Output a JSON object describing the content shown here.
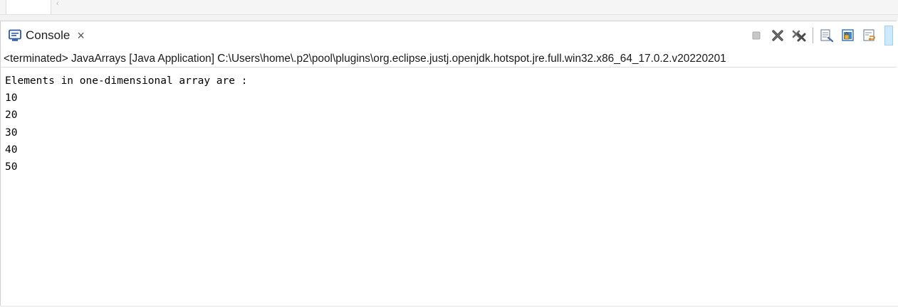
{
  "view": {
    "tab_label": "Console",
    "tab_close": "×",
    "tab_icon": "console-icon",
    "toolbar": [
      {
        "name": "terminate-icon"
      },
      {
        "name": "remove-launch-icon"
      },
      {
        "name": "remove-all-terminated-icon"
      },
      {
        "name": "clear-console-icon"
      },
      {
        "name": "scroll-lock-icon"
      },
      {
        "name": "word-wrap-icon"
      }
    ]
  },
  "status": {
    "text": "<terminated> JavaArrays [Java Application] C:\\Users\\home\\.p2\\pool\\plugins\\org.eclipse.justj.openjdk.hotspot.jre.full.win32.x86_64_17.0.2.v20220201"
  },
  "output": {
    "lines": [
      "Elements in one-dimensional array are :",
      "10",
      "20",
      "30",
      "40",
      "50"
    ]
  },
  "colors": {
    "accent": "#2a5aa8",
    "selected_button": "#cde8ff"
  }
}
